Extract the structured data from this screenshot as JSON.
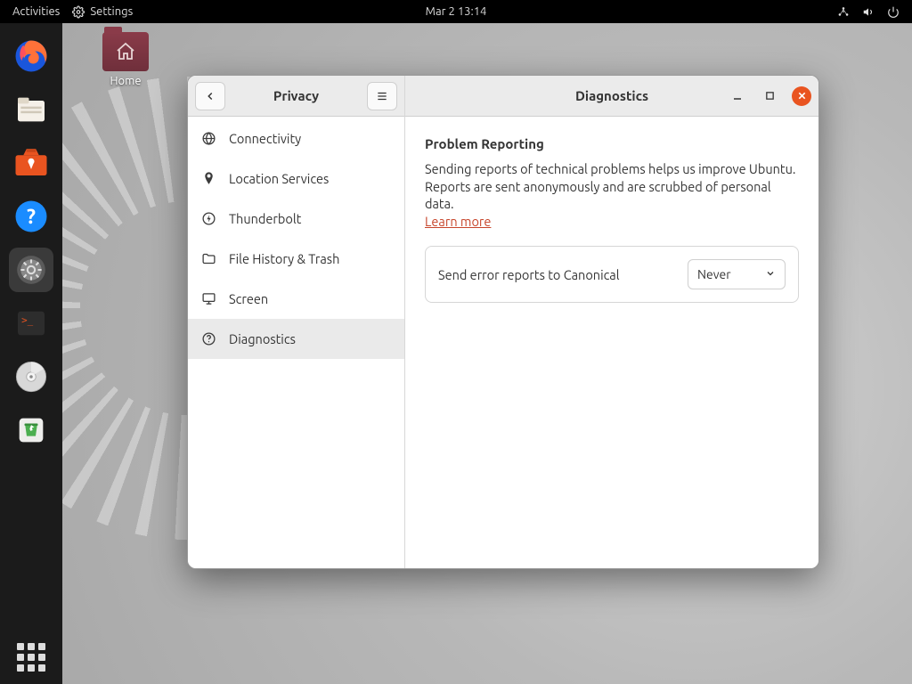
{
  "topbar": {
    "activities": "Activities",
    "app_label": "Settings",
    "datetime": "Mar 2  13:14"
  },
  "desktop": {
    "home_label": "Home"
  },
  "window": {
    "sidebar_title": "Privacy",
    "main_title": "Diagnostics",
    "nav": [
      {
        "label": "Connectivity"
      },
      {
        "label": "Location Services"
      },
      {
        "label": "Thunderbolt"
      },
      {
        "label": "File History & Trash"
      },
      {
        "label": "Screen"
      },
      {
        "label": "Diagnostics"
      }
    ],
    "section": {
      "heading": "Problem Reporting",
      "body": "Sending reports of technical problems helps us improve Ubuntu. Reports are sent anonymously and are scrubbed of personal data.",
      "learn_more": "Learn more",
      "row_label": "Send error reports to Canonical",
      "select_value": "Never"
    }
  }
}
